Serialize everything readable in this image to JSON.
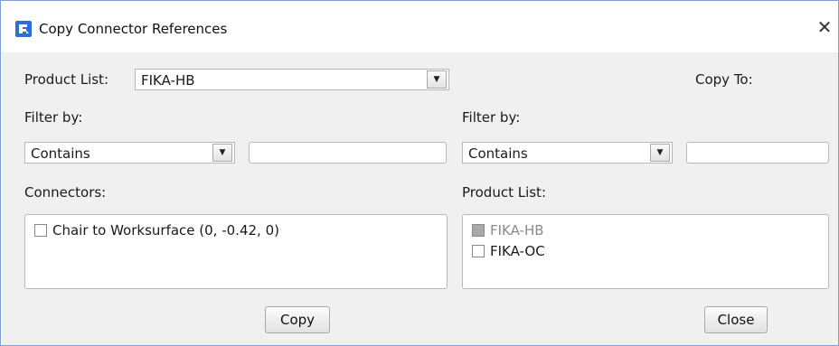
{
  "window": {
    "title": "Copy Connector References",
    "close_glyph": "✕",
    "app_icon": "app-logo-icon"
  },
  "left": {
    "product_list_label": "Product List:",
    "product_list_value": "FIKA-HB",
    "filter_label": "Filter by:",
    "filter_mode": "Contains",
    "filter_text": "",
    "connectors_label": "Connectors:",
    "connectors": [
      {
        "label": "Chair to Worksurface (0, -0.42, 0)",
        "checked": false,
        "disabled": false
      }
    ],
    "copy_button": "Copy"
  },
  "right": {
    "copy_to_label": "Copy To:",
    "filter_label": "Filter by:",
    "filter_mode": "Contains",
    "filter_text": "",
    "product_list_label": "Product List:",
    "products": [
      {
        "label": "FIKA-HB",
        "checked": false,
        "disabled": true
      },
      {
        "label": "FIKA-OC",
        "checked": false,
        "disabled": false
      }
    ],
    "close_button": "Close"
  },
  "colors": {
    "accent": "#2d6fd6",
    "panel_bg": "#f0f0f0",
    "window_border": "#7d9fd1"
  }
}
